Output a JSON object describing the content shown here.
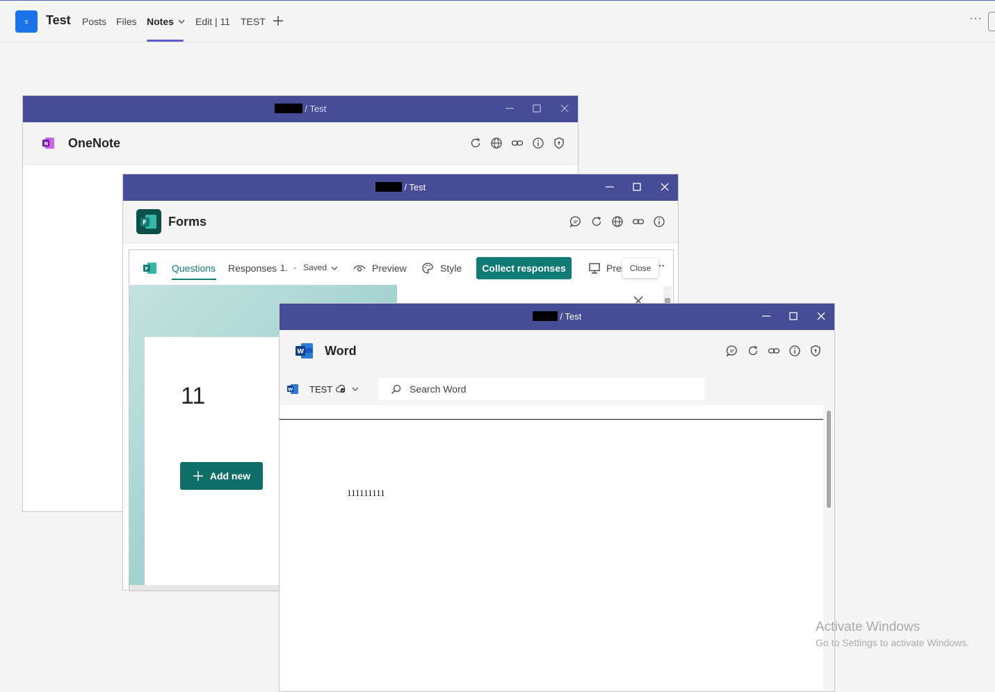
{
  "topbar": {
    "team_initial": "s",
    "team_name": "Test",
    "tabs": [
      {
        "label": "Posts"
      },
      {
        "label": "Files"
      },
      {
        "label": "Notes"
      },
      {
        "label": "Edit | 11"
      },
      {
        "label": "TEST"
      }
    ],
    "more": "···"
  },
  "onenote": {
    "title_suffix": "/ Test",
    "app_name": "OneNote"
  },
  "forms": {
    "title_suffix": "/ Test",
    "app_name": "Forms",
    "toolbar": {
      "questions": "Questions",
      "responses": "Responses",
      "responses_count": "1.",
      "dash": "-",
      "saved": "Saved",
      "preview": "Preview",
      "style": "Style",
      "collect": "Collect responses",
      "present": "Pres",
      "close_tooltip": "Close"
    },
    "form_title": "11",
    "add_new": "Add new"
  },
  "word": {
    "title_suffix": "/ Test",
    "app_name": "Word",
    "doc_name": "TEST",
    "search_placeholder": "Search Word",
    "body_text": "111111111"
  },
  "watermark": {
    "title": "Activate Windows",
    "subtitle": "Go to Settings to activate Windows."
  },
  "colors": {
    "titlebar": "#464c96",
    "accent": "#5b5fc7",
    "forms_teal": "#0f7b74"
  }
}
